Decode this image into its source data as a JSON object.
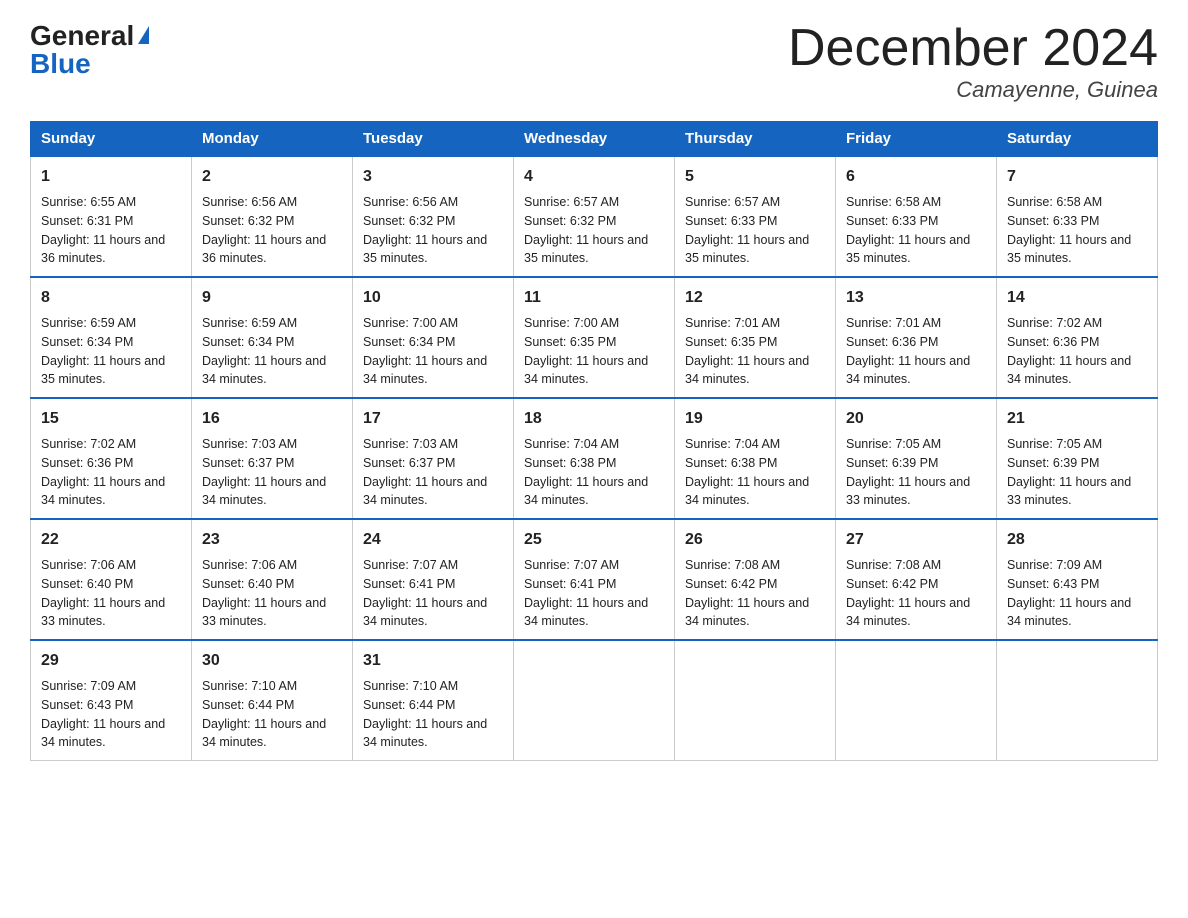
{
  "header": {
    "logo": {
      "general": "General",
      "blue": "Blue",
      "triangle": "▶"
    },
    "title": "December 2024",
    "location": "Camayenne, Guinea"
  },
  "calendar": {
    "headers": [
      "Sunday",
      "Monday",
      "Tuesday",
      "Wednesday",
      "Thursday",
      "Friday",
      "Saturday"
    ],
    "weeks": [
      [
        {
          "day": "1",
          "sunrise": "6:55 AM",
          "sunset": "6:31 PM",
          "daylight": "11 hours and 36 minutes."
        },
        {
          "day": "2",
          "sunrise": "6:56 AM",
          "sunset": "6:32 PM",
          "daylight": "11 hours and 36 minutes."
        },
        {
          "day": "3",
          "sunrise": "6:56 AM",
          "sunset": "6:32 PM",
          "daylight": "11 hours and 35 minutes."
        },
        {
          "day": "4",
          "sunrise": "6:57 AM",
          "sunset": "6:32 PM",
          "daylight": "11 hours and 35 minutes."
        },
        {
          "day": "5",
          "sunrise": "6:57 AM",
          "sunset": "6:33 PM",
          "daylight": "11 hours and 35 minutes."
        },
        {
          "day": "6",
          "sunrise": "6:58 AM",
          "sunset": "6:33 PM",
          "daylight": "11 hours and 35 minutes."
        },
        {
          "day": "7",
          "sunrise": "6:58 AM",
          "sunset": "6:33 PM",
          "daylight": "11 hours and 35 minutes."
        }
      ],
      [
        {
          "day": "8",
          "sunrise": "6:59 AM",
          "sunset": "6:34 PM",
          "daylight": "11 hours and 35 minutes."
        },
        {
          "day": "9",
          "sunrise": "6:59 AM",
          "sunset": "6:34 PM",
          "daylight": "11 hours and 34 minutes."
        },
        {
          "day": "10",
          "sunrise": "7:00 AM",
          "sunset": "6:34 PM",
          "daylight": "11 hours and 34 minutes."
        },
        {
          "day": "11",
          "sunrise": "7:00 AM",
          "sunset": "6:35 PM",
          "daylight": "11 hours and 34 minutes."
        },
        {
          "day": "12",
          "sunrise": "7:01 AM",
          "sunset": "6:35 PM",
          "daylight": "11 hours and 34 minutes."
        },
        {
          "day": "13",
          "sunrise": "7:01 AM",
          "sunset": "6:36 PM",
          "daylight": "11 hours and 34 minutes."
        },
        {
          "day": "14",
          "sunrise": "7:02 AM",
          "sunset": "6:36 PM",
          "daylight": "11 hours and 34 minutes."
        }
      ],
      [
        {
          "day": "15",
          "sunrise": "7:02 AM",
          "sunset": "6:36 PM",
          "daylight": "11 hours and 34 minutes."
        },
        {
          "day": "16",
          "sunrise": "7:03 AM",
          "sunset": "6:37 PM",
          "daylight": "11 hours and 34 minutes."
        },
        {
          "day": "17",
          "sunrise": "7:03 AM",
          "sunset": "6:37 PM",
          "daylight": "11 hours and 34 minutes."
        },
        {
          "day": "18",
          "sunrise": "7:04 AM",
          "sunset": "6:38 PM",
          "daylight": "11 hours and 34 minutes."
        },
        {
          "day": "19",
          "sunrise": "7:04 AM",
          "sunset": "6:38 PM",
          "daylight": "11 hours and 34 minutes."
        },
        {
          "day": "20",
          "sunrise": "7:05 AM",
          "sunset": "6:39 PM",
          "daylight": "11 hours and 33 minutes."
        },
        {
          "day": "21",
          "sunrise": "7:05 AM",
          "sunset": "6:39 PM",
          "daylight": "11 hours and 33 minutes."
        }
      ],
      [
        {
          "day": "22",
          "sunrise": "7:06 AM",
          "sunset": "6:40 PM",
          "daylight": "11 hours and 33 minutes."
        },
        {
          "day": "23",
          "sunrise": "7:06 AM",
          "sunset": "6:40 PM",
          "daylight": "11 hours and 33 minutes."
        },
        {
          "day": "24",
          "sunrise": "7:07 AM",
          "sunset": "6:41 PM",
          "daylight": "11 hours and 34 minutes."
        },
        {
          "day": "25",
          "sunrise": "7:07 AM",
          "sunset": "6:41 PM",
          "daylight": "11 hours and 34 minutes."
        },
        {
          "day": "26",
          "sunrise": "7:08 AM",
          "sunset": "6:42 PM",
          "daylight": "11 hours and 34 minutes."
        },
        {
          "day": "27",
          "sunrise": "7:08 AM",
          "sunset": "6:42 PM",
          "daylight": "11 hours and 34 minutes."
        },
        {
          "day": "28",
          "sunrise": "7:09 AM",
          "sunset": "6:43 PM",
          "daylight": "11 hours and 34 minutes."
        }
      ],
      [
        {
          "day": "29",
          "sunrise": "7:09 AM",
          "sunset": "6:43 PM",
          "daylight": "11 hours and 34 minutes."
        },
        {
          "day": "30",
          "sunrise": "7:10 AM",
          "sunset": "6:44 PM",
          "daylight": "11 hours and 34 minutes."
        },
        {
          "day": "31",
          "sunrise": "7:10 AM",
          "sunset": "6:44 PM",
          "daylight": "11 hours and 34 minutes."
        },
        null,
        null,
        null,
        null
      ]
    ],
    "labels": {
      "sunrise": "Sunrise:",
      "sunset": "Sunset:",
      "daylight": "Daylight:"
    }
  }
}
